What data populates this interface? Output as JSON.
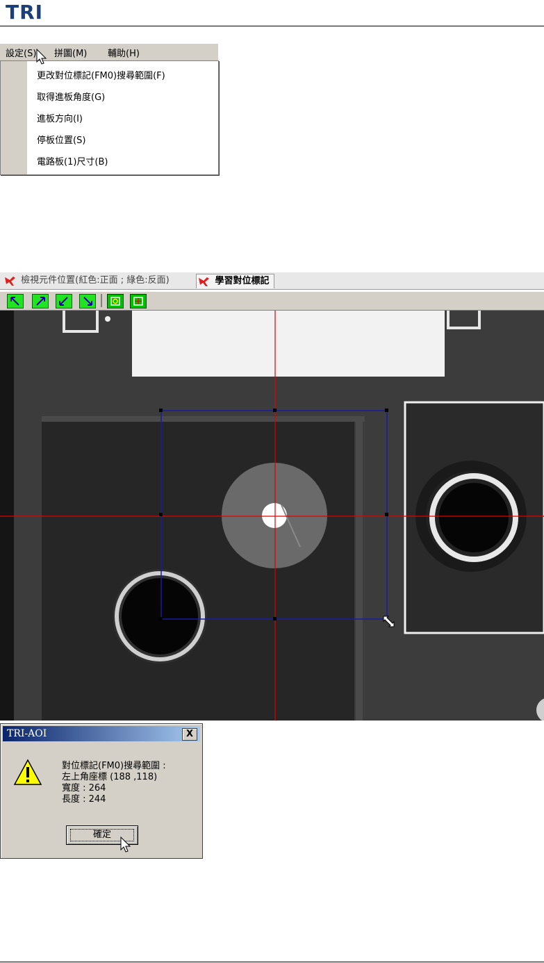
{
  "header": {
    "logo_text": "TRI"
  },
  "menu": {
    "bar_items": [
      "設定(S)",
      "拼圖(M)",
      "輔助(H)"
    ],
    "dropdown_items": [
      "更改對位標記(FM0)搜尋範圍(F)",
      "取得進板角度(G)",
      "進板方向(I)",
      "停板位置(S)",
      "電路板(1)尺寸(B)"
    ]
  },
  "app": {
    "tabs": [
      "檢視元件位置(紅色:正面 ; 綠色:反面)",
      "學習對位標記"
    ],
    "toolbar_icons": [
      "arrow-nw-icon",
      "arrow-ne-icon",
      "arrow-sw-icon",
      "arrow-se-icon",
      "fit-box-icon",
      "target-box-icon"
    ]
  },
  "dialog": {
    "title": "TRI-AOI",
    "close_label": "X",
    "line1": "對位標記(FM0)搜尋範圍 :",
    "line2": "左上角座標 (188 ,118)",
    "line3": "寬度 : 264",
    "line4": "長度 : 244",
    "ok_label": "確定"
  },
  "colors": {
    "crosshair": "#e00000",
    "search_box": "#1a1aa0",
    "toolbar_button": "#22e322"
  }
}
